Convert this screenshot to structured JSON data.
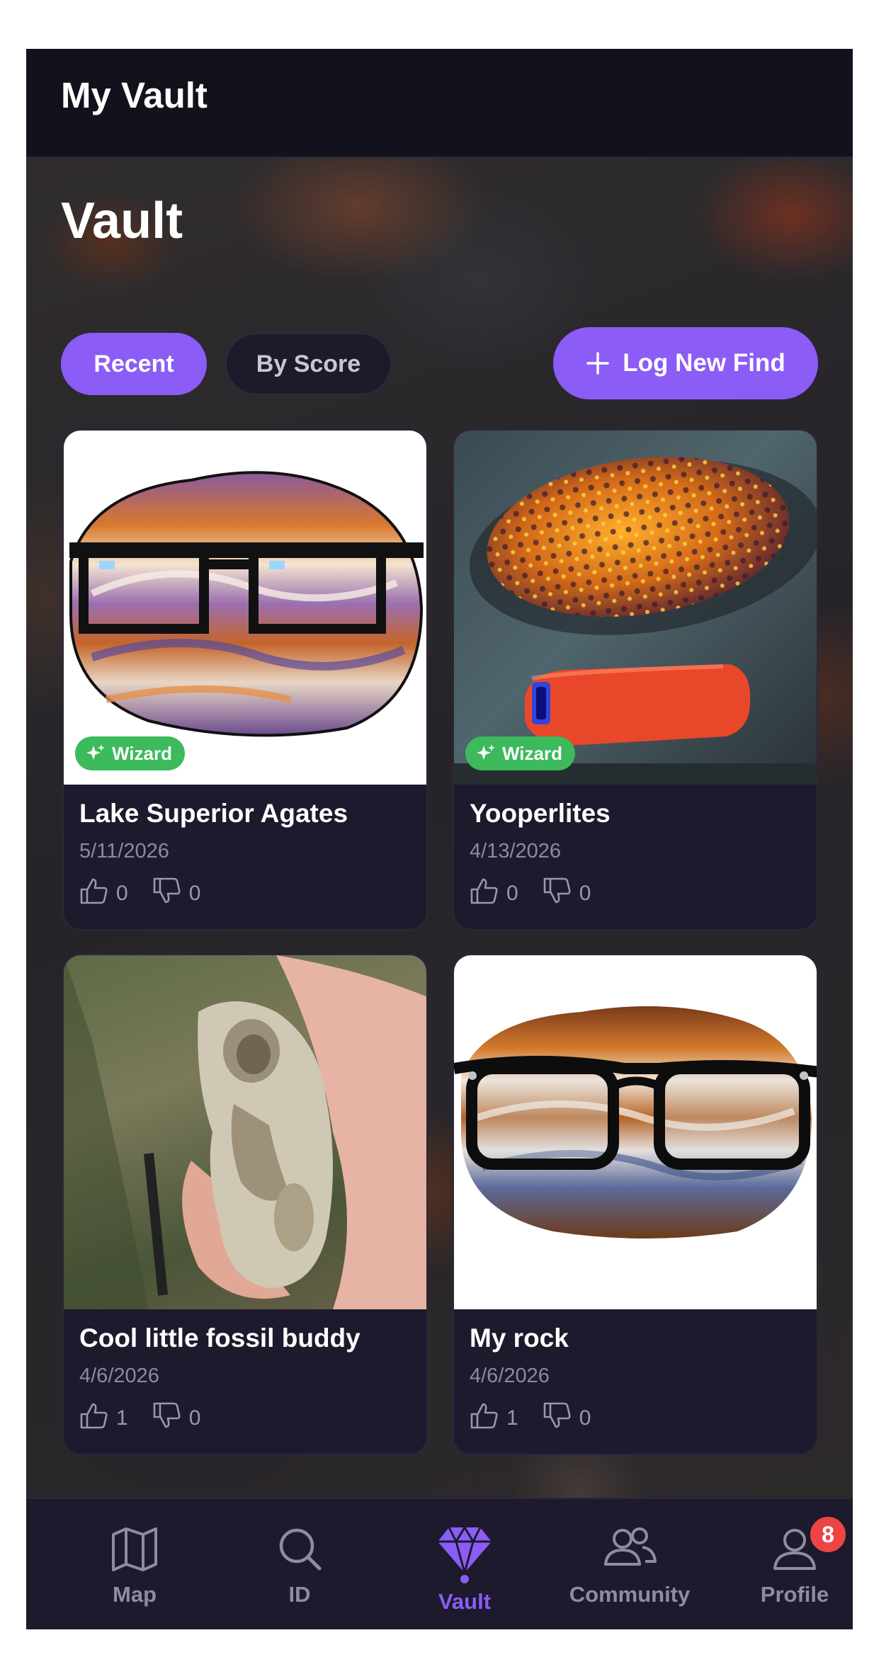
{
  "header": {
    "title": "My Vault"
  },
  "vault": {
    "title": "Vault",
    "filters": {
      "recent": "Recent",
      "by_score": "By Score"
    },
    "log_button": "Log New Find"
  },
  "cards": [
    {
      "title": "Lake Superior Agates",
      "date": "5/11/2026",
      "badge": "Wizard",
      "likes": "0",
      "dislikes": "0"
    },
    {
      "title": "Yooperlites",
      "date": "4/13/2026",
      "badge": "Wizard",
      "likes": "0",
      "dislikes": "0"
    },
    {
      "title": "Cool little fossil buddy",
      "date": "4/6/2026",
      "likes": "1",
      "dislikes": "0"
    },
    {
      "title": "My rock",
      "date": "4/6/2026",
      "likes": "1",
      "dislikes": "0"
    }
  ],
  "tabs": [
    {
      "label": "Map",
      "icon": "map-icon"
    },
    {
      "label": "ID",
      "icon": "search-icon"
    },
    {
      "label": "Vault",
      "icon": "diamond-icon",
      "active": true
    },
    {
      "label": "Community",
      "icon": "people-icon"
    },
    {
      "label": "Profile",
      "icon": "user-icon",
      "badge": "8"
    }
  ],
  "colors": {
    "accent": "#8b5cf6",
    "badge_green": "#3cba5c",
    "notification": "#ef4444",
    "background": "#17151f"
  }
}
